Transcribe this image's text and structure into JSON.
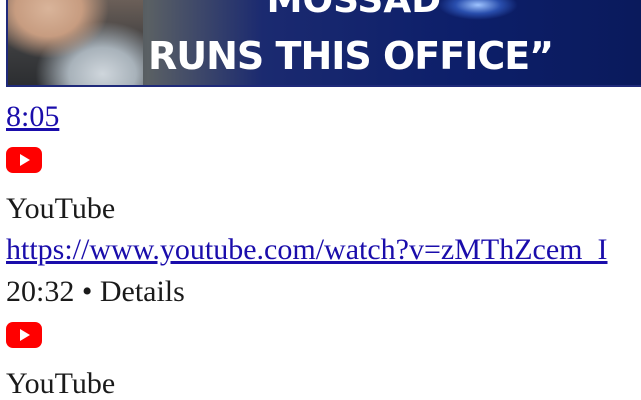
{
  "thumbnail": {
    "headline_line1": "“MOSSAD",
    "headline_line2": "RUNS THIS OFFICE”"
  },
  "results": [
    {
      "duration": "8:05",
      "icon": "youtube-icon",
      "source": "YouTube",
      "url": "https://www.youtube.com/watch?v=zMThZcem_I"
    },
    {
      "meta": "20:32 • Details",
      "icon": "youtube-icon",
      "source": "YouTube"
    }
  ],
  "colors": {
    "link": "#1a0dab",
    "youtube_red": "#ff0000",
    "thumbnail_border": "#1f2a7a"
  }
}
